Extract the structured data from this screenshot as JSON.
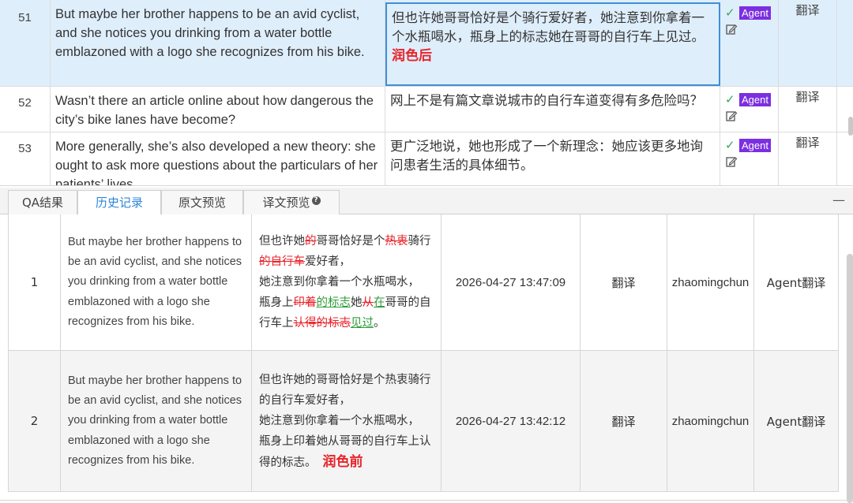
{
  "segments": [
    {
      "num": "51",
      "source": "But maybe her brother happens to be an avid cyclist, and she notices you drinking from a water bottle emblazoned with a logo she recognizes from his bike.",
      "target": "但也许她哥哥恰好是个骑行爱好者，她注意到你拿着一个水瓶喝水，瓶身上的标志她在哥哥的自行车上见过。",
      "annotation": "润色后",
      "badge": "Agent",
      "type": "翻译"
    },
    {
      "num": "52",
      "source": "Wasn’t there an article online about how dangerous the city’s bike lanes have become?",
      "target": "网上不是有篇文章说城市的自行车道变得有多危险吗？",
      "badge": "Agent",
      "type": "翻译"
    },
    {
      "num": "53",
      "source": "More generally, she’s also developed a new theory: she ought to ask more questions about the particulars of her patients’ lives.",
      "target": "更广泛地说，她也形成了一个新理念：她应该更多地询问患者生活的具体细节。",
      "badge": "Agent",
      "type": "翻译"
    }
  ],
  "tabs": {
    "qa": "QA结果",
    "history": "历史记录",
    "source_preview": "原文预览",
    "target_preview": "译文预览",
    "help": "?"
  },
  "minimize": "—",
  "history": [
    {
      "num": "1",
      "source": "But maybe her brother happens to be an avid cyclist, and she notices you drinking from a water bottle emblazoned with a logo she recognizes from his bike.",
      "diff": [
        [
          "",
          "但也许她"
        ],
        [
          "del",
          "的"
        ],
        [
          "",
          "哥哥恰好是个"
        ],
        [
          "del",
          "热衷"
        ],
        [
          "",
          "骑行"
        ],
        [
          "del",
          "的自行车"
        ],
        [
          "",
          "爱好者，"
        ],
        [
          "br",
          ""
        ],
        [
          "",
          "她注意到你拿着一个水瓶喝水，"
        ],
        [
          "br",
          ""
        ],
        [
          "",
          "瓶身上"
        ],
        [
          "del",
          "印着"
        ],
        [
          "ins",
          "的标志"
        ],
        [
          "",
          "她"
        ],
        [
          "del",
          "从"
        ],
        [
          "ins",
          "在"
        ],
        [
          "",
          "哥哥的自行车上"
        ],
        [
          "del",
          "认得的标志"
        ],
        [
          "ins",
          "见过"
        ],
        [
          "",
          "。"
        ]
      ],
      "time": "2026-04-27 13:47:09",
      "action": "翻译",
      "user": "zhaomingchun",
      "mode": "Agent翻译"
    },
    {
      "num": "2",
      "source": "But maybe her brother happens to be an avid cyclist, and she notices you drinking from a water bottle emblazoned with a logo she recognizes from his bike.",
      "target_lines": [
        "但也许她的哥哥恰好是个热衷骑行的自行车爱好者，",
        "她注意到你拿着一个水瓶喝水，",
        "瓶身上印着她从哥哥的自行车上认得的标志。"
      ],
      "annotation": "润色前",
      "time": "2026-04-27 13:42:12",
      "action": "翻译",
      "user": "zhaomingchun",
      "mode": "Agent翻译"
    }
  ],
  "colors": {
    "accent": "#2f86d8",
    "agent_badge": "#7b2fe0",
    "deleted": "#e8232a",
    "inserted": "#2f9c3a",
    "check": "#3aa55a",
    "selected_row": "#dfeefb"
  }
}
